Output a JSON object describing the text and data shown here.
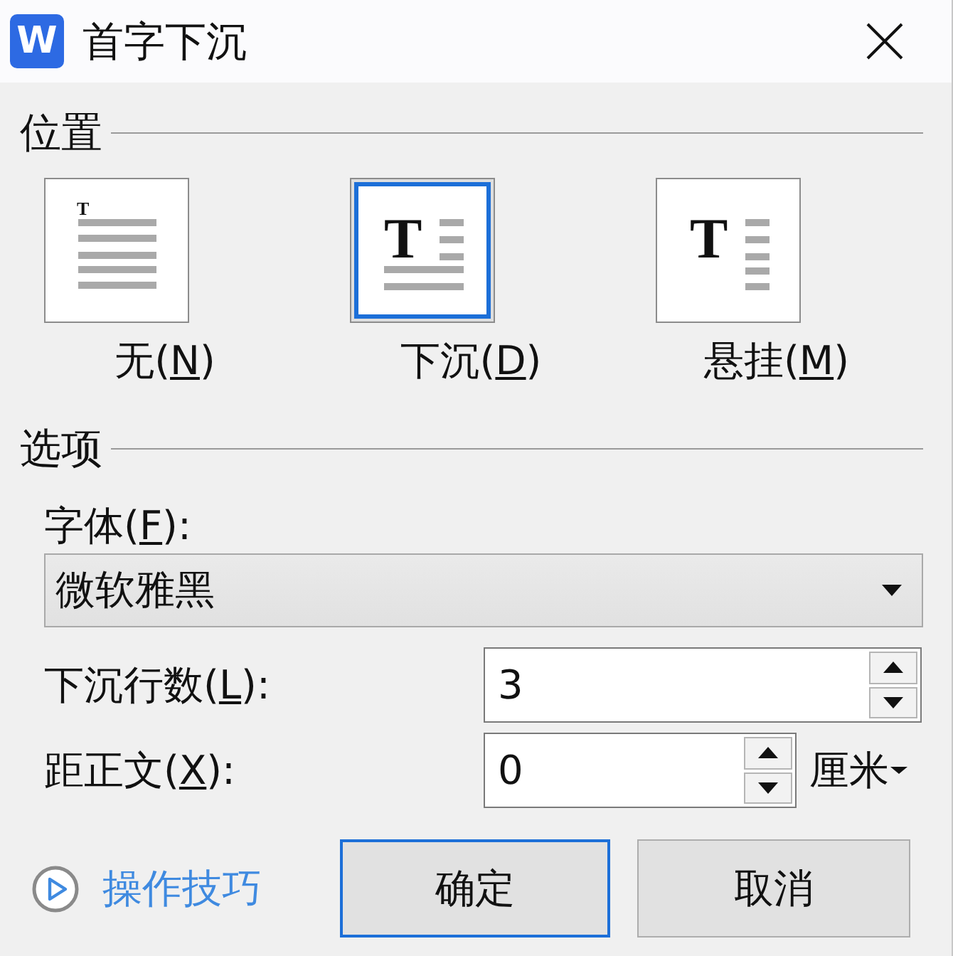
{
  "window": {
    "app_badge": "W",
    "title": "首字下沉"
  },
  "position": {
    "heading": "位置",
    "options": [
      {
        "kind": "none",
        "glyph": "T",
        "label": "无(",
        "access_key": "N",
        "label_end": ")",
        "selected": false
      },
      {
        "kind": "dropped",
        "glyph": "T",
        "label": "下沉(",
        "access_key": "D",
        "label_end": ")",
        "selected": true
      },
      {
        "kind": "margin",
        "glyph": "T",
        "label": "悬挂(",
        "access_key": "M",
        "label_end": ")",
        "selected": false
      }
    ]
  },
  "options": {
    "heading": "选项",
    "font": {
      "label": "字体(",
      "access_key": "F",
      "label_end": "):",
      "value": "微软雅黑"
    },
    "drop_lines": {
      "label": "下沉行数(",
      "access_key": "L",
      "label_end": "):",
      "value": "3"
    },
    "distance": {
      "label": "距正文(",
      "access_key": "X",
      "label_end": "):",
      "value": "0",
      "unit": "厘米"
    }
  },
  "footer": {
    "tips_link": "操作技巧",
    "buttons": [
      {
        "label": "确定",
        "default": true
      },
      {
        "label": "取消",
        "default": false
      }
    ]
  }
}
